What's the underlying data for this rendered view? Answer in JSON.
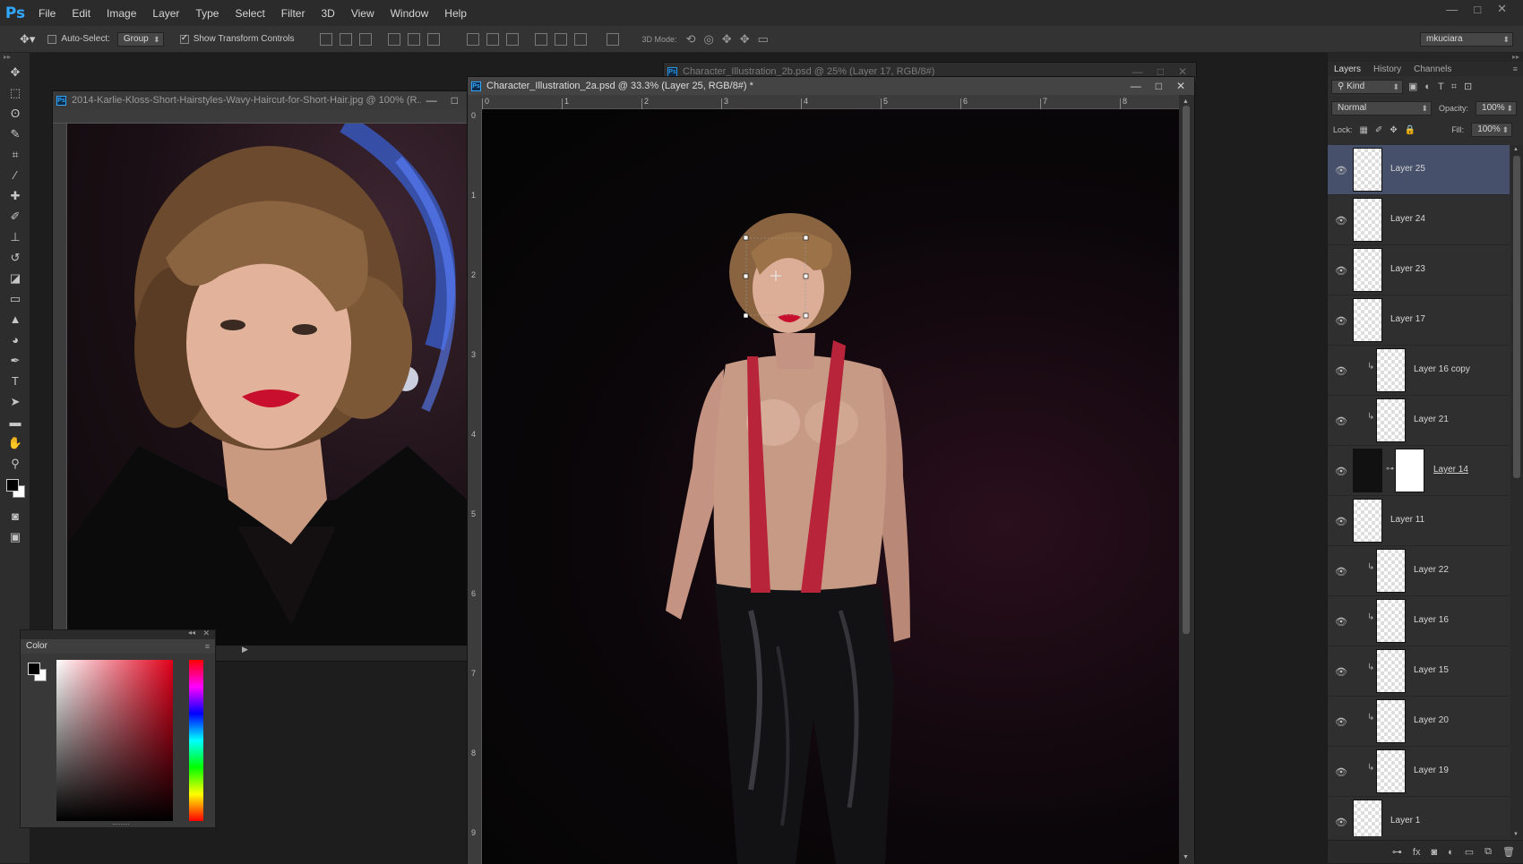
{
  "app": {
    "logo": "Ps",
    "menu": [
      "File",
      "Edit",
      "Image",
      "Layer",
      "Type",
      "Select",
      "Filter",
      "3D",
      "View",
      "Window",
      "Help"
    ],
    "window_controls": [
      "—",
      "□",
      "✕"
    ]
  },
  "options_bar": {
    "auto_select_label": "Auto-Select:",
    "auto_select_value": "Group",
    "show_transform_label": "Show Transform Controls",
    "mode_3d_label": "3D Mode:",
    "workspace": "mkuciara"
  },
  "documents": {
    "reference": {
      "title": "2014-Karlie-Kloss-Short-Hairstyles-Wavy-Haircut-for-Short-Hair.jpg @ 100% (R..."
    },
    "main": {
      "title": "Character_Illustration_2a.psd @ 33.3% (Layer 25, RGB/8#) *",
      "ruler_h": [
        "0",
        "1",
        "2",
        "3",
        "4",
        "5",
        "6",
        "7",
        "8"
      ],
      "ruler_v": [
        "0",
        "1",
        "2",
        "3",
        "4",
        "5",
        "6",
        "7",
        "8",
        "9"
      ]
    },
    "background": {
      "title": "Character_Illustration_2b.psd @ 25% (Layer 17, RGB/8#)"
    }
  },
  "color_panel": {
    "title": "Color"
  },
  "layers_panel": {
    "tabs": [
      "Layers",
      "History",
      "Channels"
    ],
    "filter_label": "Kind",
    "blend_mode": "Normal",
    "opacity_label": "Opacity:",
    "opacity_value": "100%",
    "lock_label": "Lock:",
    "fill_label": "Fill:",
    "fill_value": "100%",
    "layers": [
      {
        "name": "Layer 25",
        "selected": true,
        "clipped": false
      },
      {
        "name": "Layer 24",
        "selected": false,
        "clipped": false
      },
      {
        "name": "Layer 23",
        "selected": false,
        "clipped": false
      },
      {
        "name": "Layer 17",
        "selected": false,
        "clipped": false
      },
      {
        "name": "Layer 16 copy",
        "selected": false,
        "clipped": true
      },
      {
        "name": "Layer 21",
        "selected": false,
        "clipped": true
      },
      {
        "name": "Layer 14",
        "selected": false,
        "clipped": false,
        "mask": true
      },
      {
        "name": "Layer 11",
        "selected": false,
        "clipped": false
      },
      {
        "name": "Layer 22",
        "selected": false,
        "clipped": true
      },
      {
        "name": "Layer 16",
        "selected": false,
        "clipped": true
      },
      {
        "name": "Layer 15",
        "selected": false,
        "clipped": true
      },
      {
        "name": "Layer 20",
        "selected": false,
        "clipped": true
      },
      {
        "name": "Layer 19",
        "selected": false,
        "clipped": true
      },
      {
        "name": "Layer 1",
        "selected": false,
        "clipped": false
      }
    ]
  },
  "colors": {
    "accent": "#31a8ff",
    "selected_layer": "#47506a",
    "lipstick_red": "#c8102e"
  }
}
